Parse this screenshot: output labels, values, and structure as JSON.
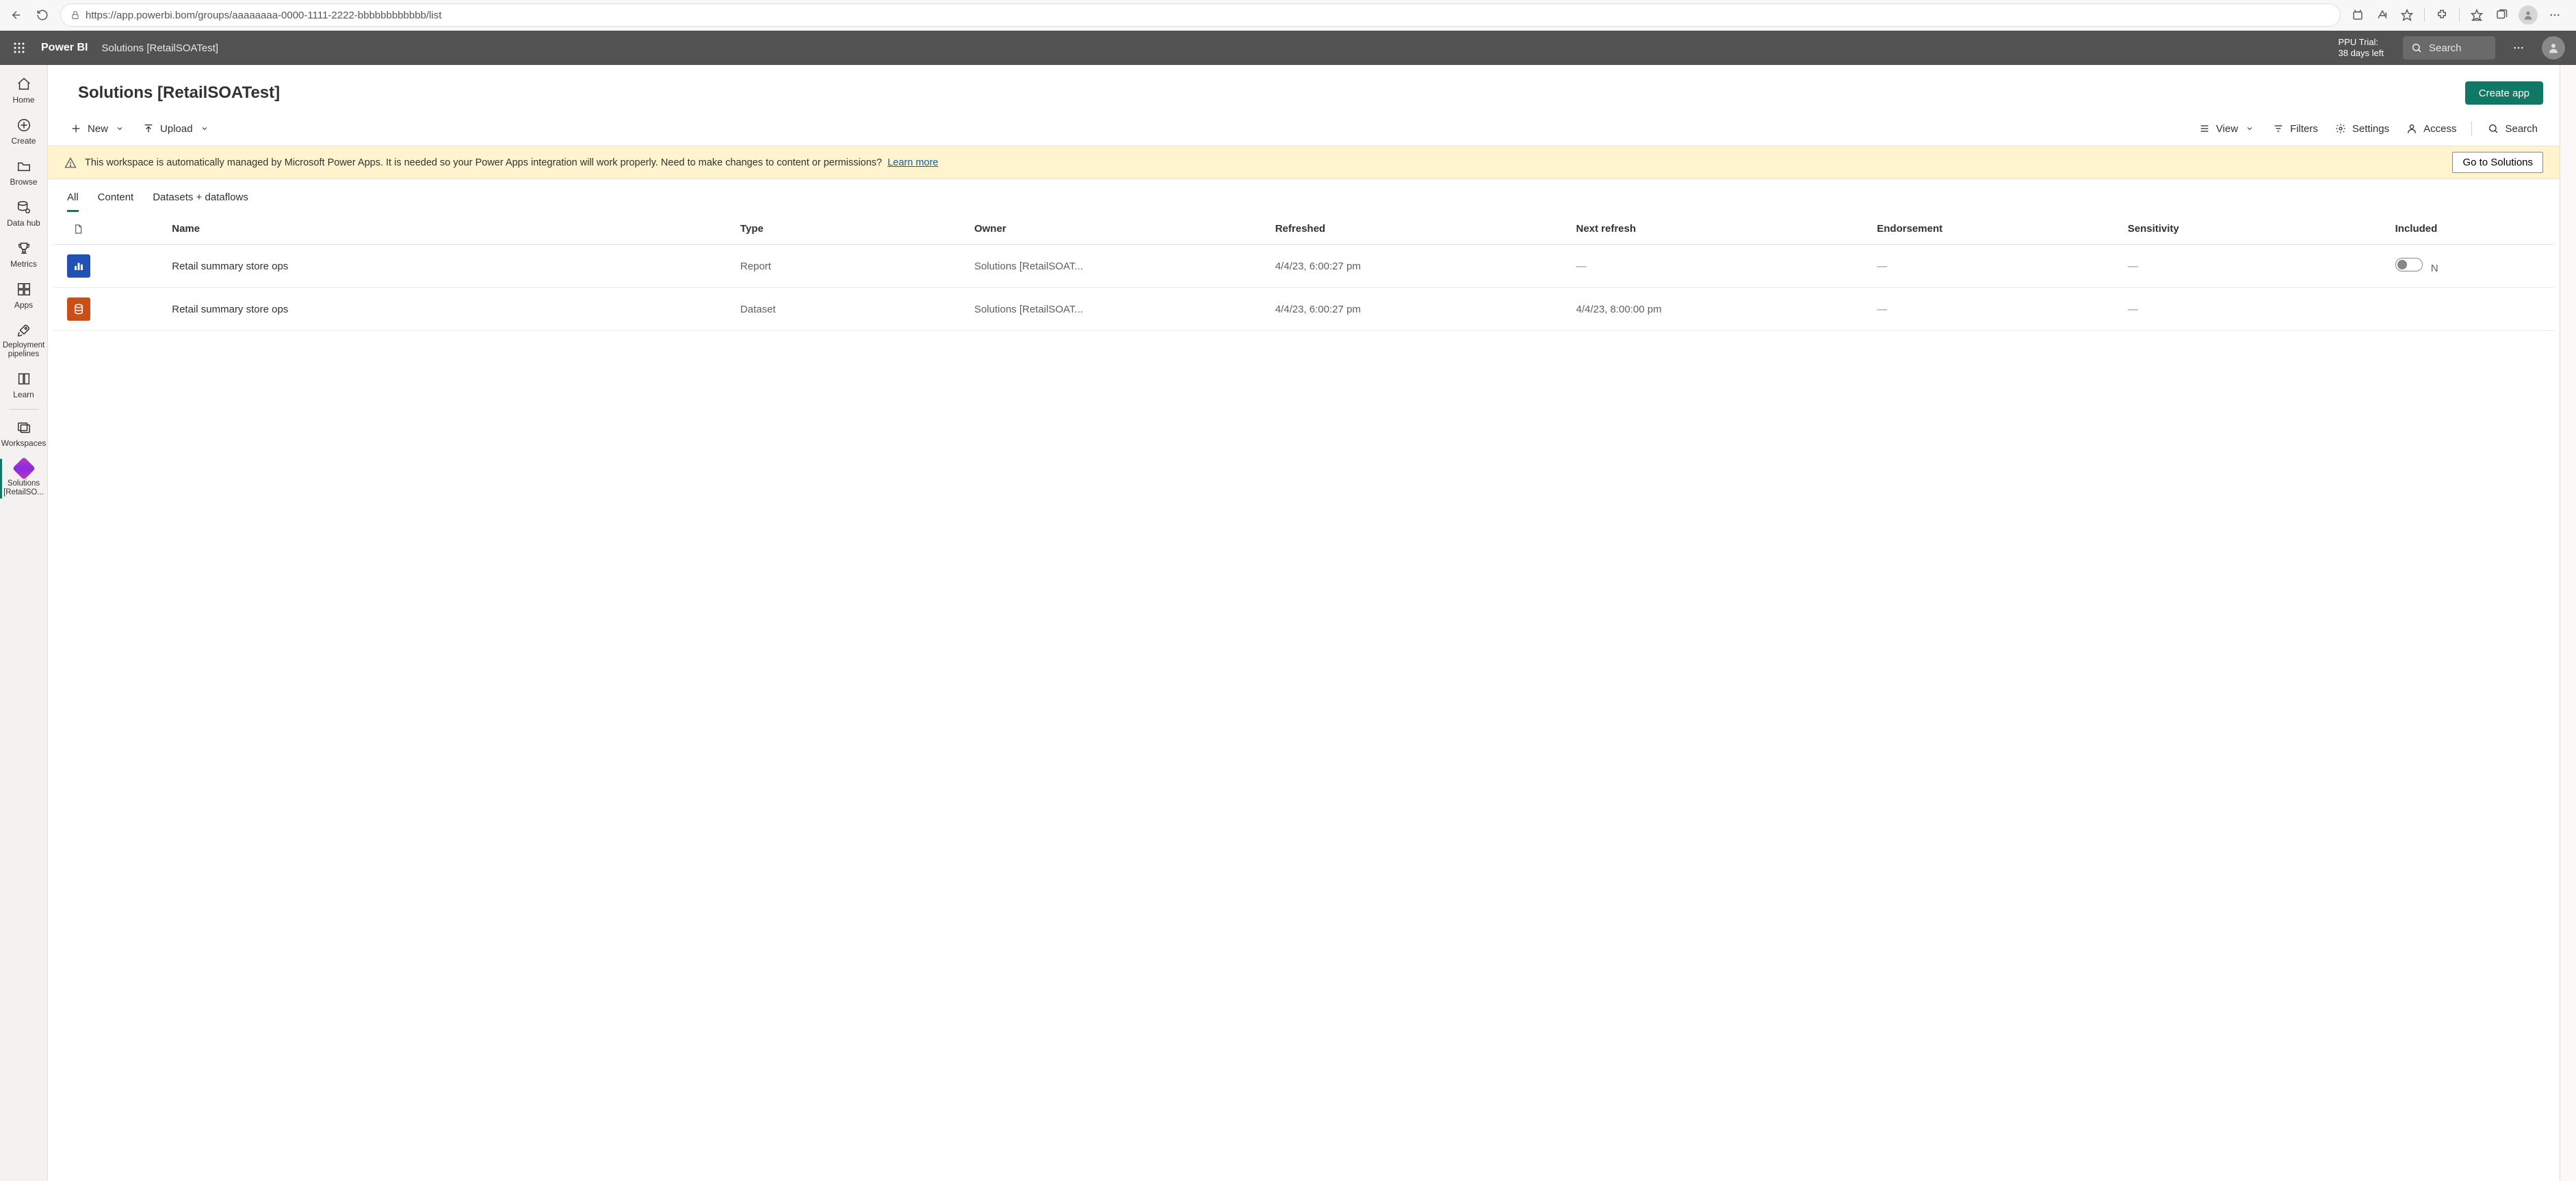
{
  "browser": {
    "url": "https://app.powerbi.bom/groups/aaaaaaaa-0000-1111-2222-bbbbbbbbbbbb/list"
  },
  "top": {
    "brand": "Power BI",
    "breadcrumb": "Solutions [RetailSOATest]",
    "trial_line1": "PPU Trial:",
    "trial_line2": "38 days left",
    "search_placeholder": "Search"
  },
  "leftnav": {
    "home": "Home",
    "create": "Create",
    "browse": "Browse",
    "datahub": "Data hub",
    "metrics": "Metrics",
    "apps": "Apps",
    "deploy": "Deployment pipelines",
    "learn": "Learn",
    "workspaces": "Workspaces",
    "current_ws": "Solutions [RetailSO..."
  },
  "header": {
    "title": "Solutions [RetailSOATest]",
    "create_app": "Create app"
  },
  "toolbar": {
    "new": "New",
    "upload": "Upload",
    "view": "View",
    "filters": "Filters",
    "settings": "Settings",
    "access": "Access",
    "search": "Search"
  },
  "banner": {
    "text": "This workspace is automatically managed by Microsoft Power Apps. It is needed so your Power Apps integration will work properly. Need to make changes to content or permissions?",
    "link": "Learn more",
    "button": "Go to Solutions"
  },
  "tabs": {
    "all": "All",
    "content": "Content",
    "datasets": "Datasets + dataflows"
  },
  "columns": {
    "name": "Name",
    "type": "Type",
    "owner": "Owner",
    "refreshed": "Refreshed",
    "next_refresh": "Next refresh",
    "endorsement": "Endorsement",
    "sensitivity": "Sensitivity",
    "included": "Included"
  },
  "rows": [
    {
      "kind": "report",
      "name": "Retail summary store ops",
      "type": "Report",
      "owner": "Solutions [RetailSOAT...",
      "refreshed": "4/4/23, 6:00:27 pm",
      "next_refresh": "—",
      "endorsement": "—",
      "sensitivity": "—",
      "included_toggle": true,
      "included_extra": "N"
    },
    {
      "kind": "dataset",
      "name": "Retail summary store ops",
      "type": "Dataset",
      "owner": "Solutions [RetailSOAT...",
      "refreshed": "4/4/23, 6:00:27 pm",
      "next_refresh": "4/4/23, 8:00:00 pm",
      "endorsement": "—",
      "sensitivity": "—",
      "included_toggle": false,
      "included_extra": ""
    }
  ]
}
